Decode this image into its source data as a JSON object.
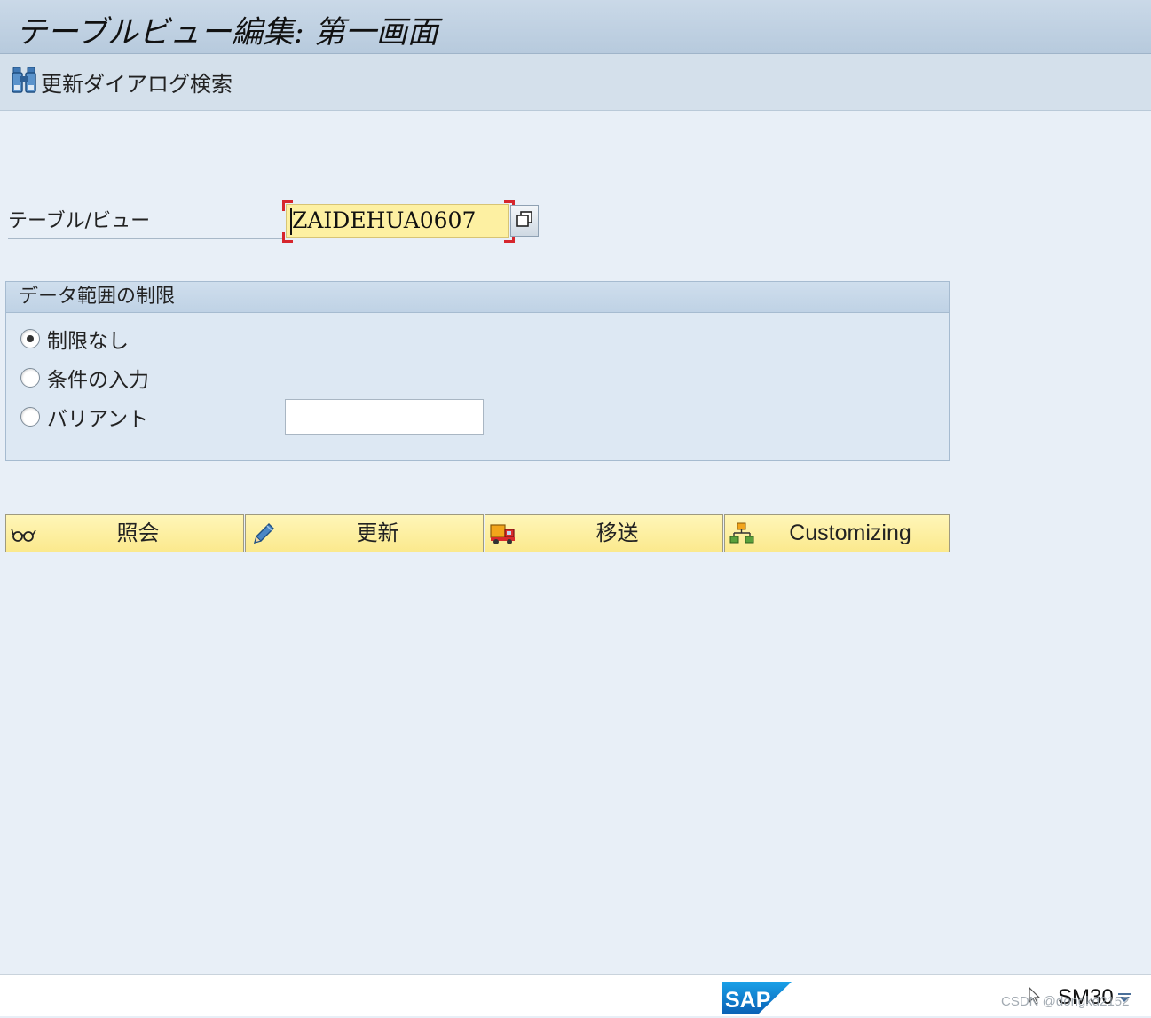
{
  "window": {
    "title": "テーブルビュー編集: 第一画面"
  },
  "toolbar": {
    "search_dialog_label": "更新ダイアログ検索"
  },
  "table_field": {
    "label": "テーブル/ビュー",
    "value": "ZAIDEHUA0607"
  },
  "restriction_group": {
    "title": "データ範囲の制限",
    "options": [
      {
        "label": "制限なし",
        "selected": true
      },
      {
        "label": "条件の入力",
        "selected": false
      },
      {
        "label": "バリアント",
        "selected": false
      }
    ],
    "variant_value": ""
  },
  "actions": {
    "display_label": "照会",
    "maintain_label": "更新",
    "transport_label": "移送",
    "customizing_label": "Customizing"
  },
  "status_bar": {
    "logo": "SAP",
    "transaction_code": "SM30",
    "watermark": "CSDN @dongkd2152"
  },
  "colors": {
    "background": "#e8eff7",
    "title_bar": "#b7cadd",
    "required_field": "#fdf0a2",
    "required_marker": "#d6262d",
    "button": "#fbe98d",
    "sap_blue": "#0a73c9"
  }
}
